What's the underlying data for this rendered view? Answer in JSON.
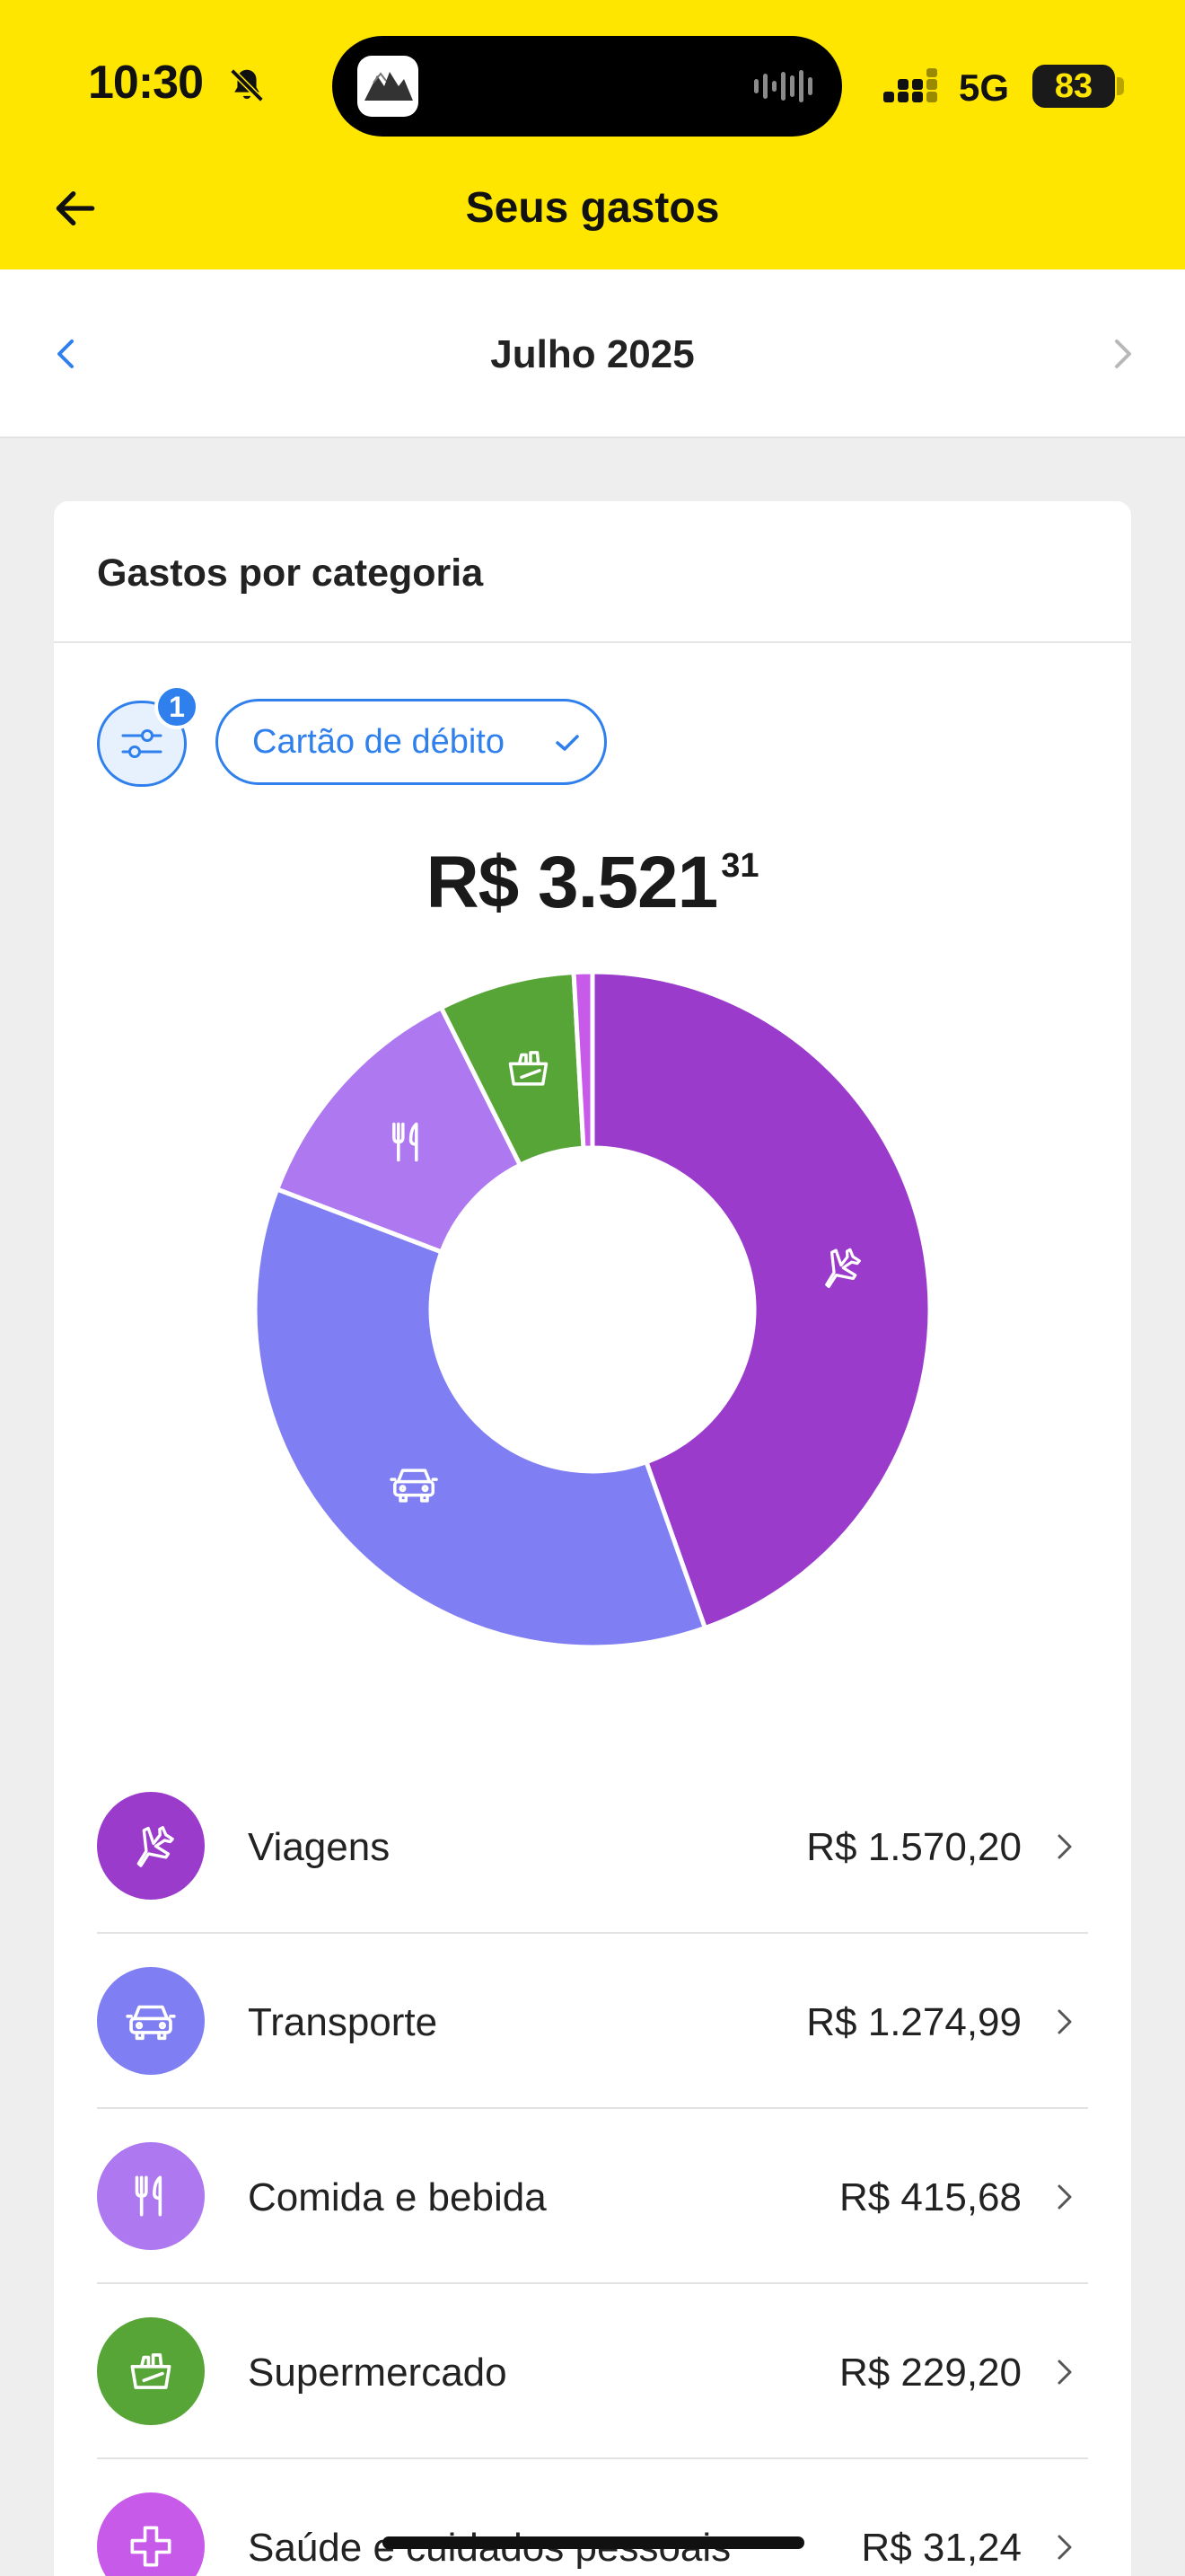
{
  "status_bar": {
    "time": "10:30",
    "network": "5G",
    "battery": "83"
  },
  "header": {
    "title": "Seus gastos"
  },
  "month_selector": {
    "label": "Julho 2025"
  },
  "card": {
    "title": "Gastos por categoria",
    "filter_count": "1",
    "filter_chip": "Cartão de débito",
    "total_main": "R$ 3.521",
    "total_cents": "31"
  },
  "categories": [
    {
      "name": "Viagens",
      "amount": "R$ 1.570,20",
      "color": "#9b3bcc",
      "icon": "airplane-icon"
    },
    {
      "name": "Transporte",
      "amount": "R$ 1.274,99",
      "color": "#7f7ff3",
      "icon": "car-icon"
    },
    {
      "name": "Comida e bebida",
      "amount": "R$ 415,68",
      "color": "#ad78f0",
      "icon": "cutlery-icon"
    },
    {
      "name": "Supermercado",
      "amount": "R$ 229,20",
      "color": "#56a536",
      "icon": "shopping-basket-icon"
    },
    {
      "name": "Saúde e cuidados pessoais",
      "amount": "R$ 31,24",
      "color": "#c75ae8",
      "icon": "health-cross-icon"
    }
  ],
  "chart_data": {
    "type": "pie",
    "title": "",
    "categories": [
      "Viagens",
      "Transporte",
      "Comida e bebida",
      "Supermercado",
      "Saúde e cuidados pessoais"
    ],
    "values": [
      1570.2,
      1274.99,
      415.68,
      229.2,
      31.24
    ],
    "colors": [
      "#9b3bcc",
      "#7f7ff3",
      "#ad78f0",
      "#56a536",
      "#c75ae8"
    ]
  }
}
